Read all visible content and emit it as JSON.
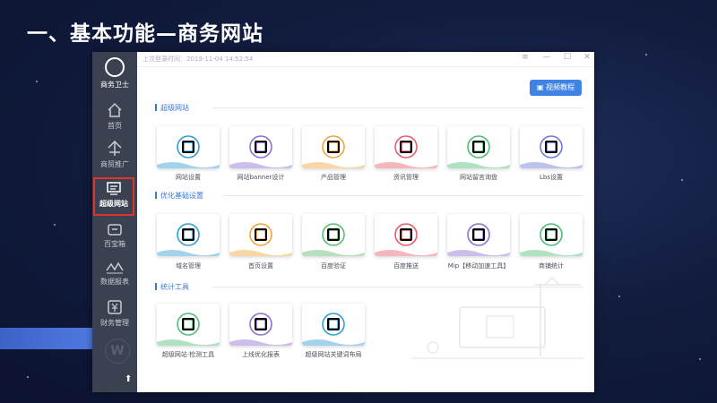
{
  "slide": {
    "title": "一、基本功能—商务网站"
  },
  "sidebar": {
    "brand": "商务卫士",
    "items": [
      {
        "label": "首页"
      },
      {
        "label": "商贸推广"
      },
      {
        "label": "超级网站"
      },
      {
        "label": "百宝箱"
      },
      {
        "label": "数据报表"
      },
      {
        "label": "财务管理"
      }
    ],
    "watermark": "W",
    "up_arrow": "⬆"
  },
  "titlebar": {
    "login_time": "上次登录时间：2019-11-04 14:52:54",
    "controls": [
      "≡",
      "—",
      "☐",
      "✕"
    ]
  },
  "toolbar": {
    "video_button": "视频教程"
  },
  "sections": [
    {
      "title": "超级网站",
      "items": [
        {
          "label": "网站设置",
          "icon": "website-settings-icon",
          "color": "#2f9fd6"
        },
        {
          "label": "网站banner设计",
          "icon": "banner-image-icon",
          "color": "#8f6fd6"
        },
        {
          "label": "产品管理",
          "icon": "product-box-icon",
          "color": "#f2a43a"
        },
        {
          "label": "资讯管理",
          "icon": "news-icon",
          "color": "#e85d6a"
        },
        {
          "label": "网站留言询盘",
          "icon": "message-icon",
          "color": "#4cbf73"
        },
        {
          "label": "Lbs设置",
          "icon": "location-pin-icon",
          "color": "#6c79d8"
        }
      ]
    },
    {
      "title": "优化基础设置",
      "items": [
        {
          "label": "域名管理",
          "icon": "www-domain-icon",
          "color": "#2f9fd6"
        },
        {
          "label": "首页设置",
          "icon": "homepage-icon",
          "color": "#f2a43a"
        },
        {
          "label": "百度验证",
          "icon": "verify-icon",
          "color": "#5cbf6a"
        },
        {
          "label": "百度推送",
          "icon": "push-icon",
          "color": "#e85d6a"
        },
        {
          "label": "Mip【移动加速工具】",
          "icon": "mobile-accelerate-icon",
          "color": "#8f6fd6"
        },
        {
          "label": "商铺统计",
          "icon": "shop-stats-icon",
          "color": "#4cbf73"
        }
      ]
    },
    {
      "title": "统计工具",
      "items": [
        {
          "label": "超级网站·检测工具",
          "icon": "detect-icon",
          "color": "#4cbf73"
        },
        {
          "label": "上线优化报表",
          "icon": "report-chart-icon",
          "color": "#8f6fd6"
        },
        {
          "label": "超级网站关键词布局",
          "icon": "keyword-layout-icon",
          "color": "#2f9fd6"
        }
      ]
    }
  ]
}
